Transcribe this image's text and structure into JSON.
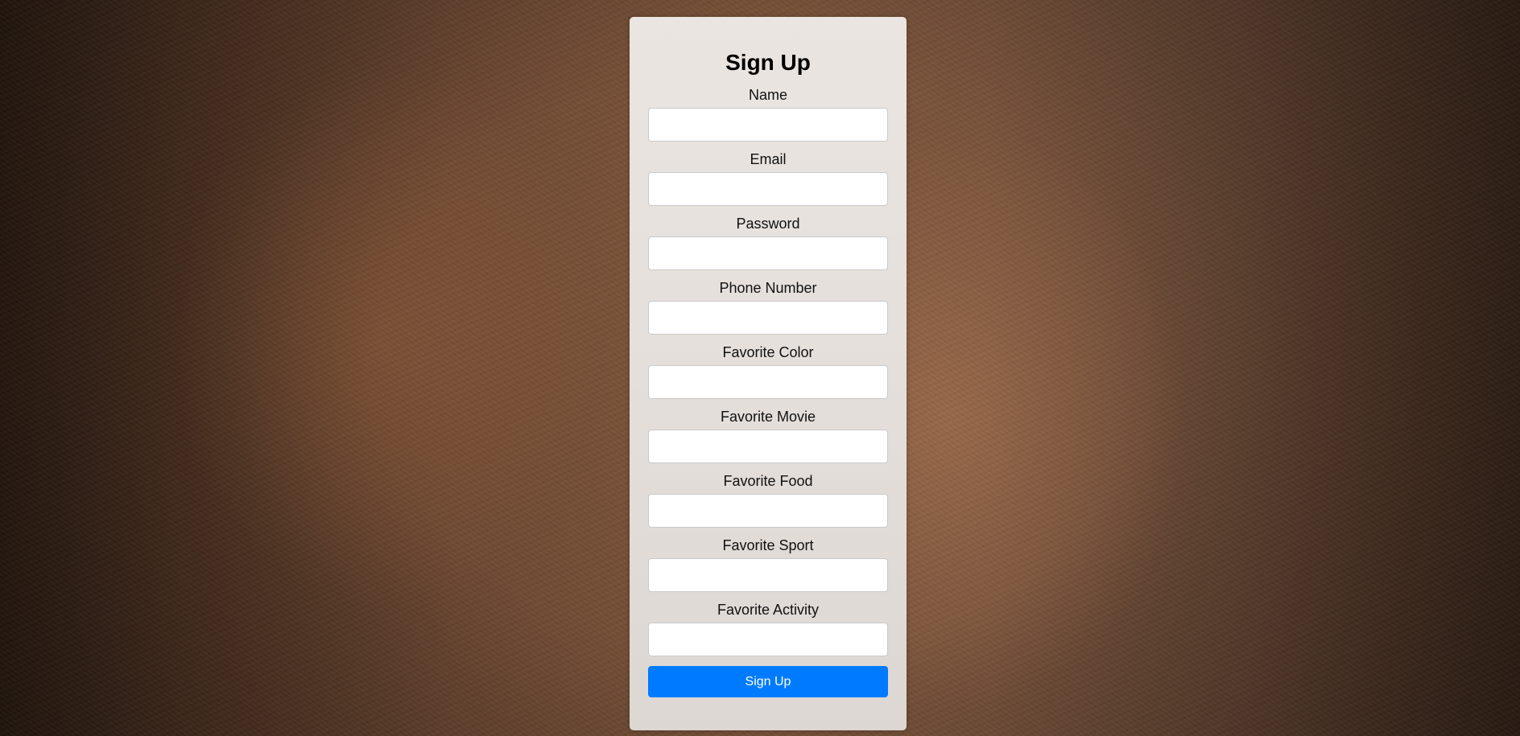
{
  "form": {
    "title": "Sign Up",
    "fields": [
      {
        "label": "Name",
        "value": "",
        "placeholder": ""
      },
      {
        "label": "Email",
        "value": "",
        "placeholder": ""
      },
      {
        "label": "Password",
        "value": "",
        "placeholder": ""
      },
      {
        "label": "Phone Number",
        "value": "",
        "placeholder": ""
      },
      {
        "label": "Favorite Color",
        "value": "",
        "placeholder": ""
      },
      {
        "label": "Favorite Movie",
        "value": "",
        "placeholder": ""
      },
      {
        "label": "Favorite Food",
        "value": "",
        "placeholder": ""
      },
      {
        "label": "Favorite Sport",
        "value": "",
        "placeholder": ""
      },
      {
        "label": "Favorite Activity",
        "value": "",
        "placeholder": ""
      }
    ],
    "submit_label": "Sign Up"
  },
  "colors": {
    "button": "#007bff",
    "button_text": "#ffffff",
    "card": "#e8e2de"
  }
}
